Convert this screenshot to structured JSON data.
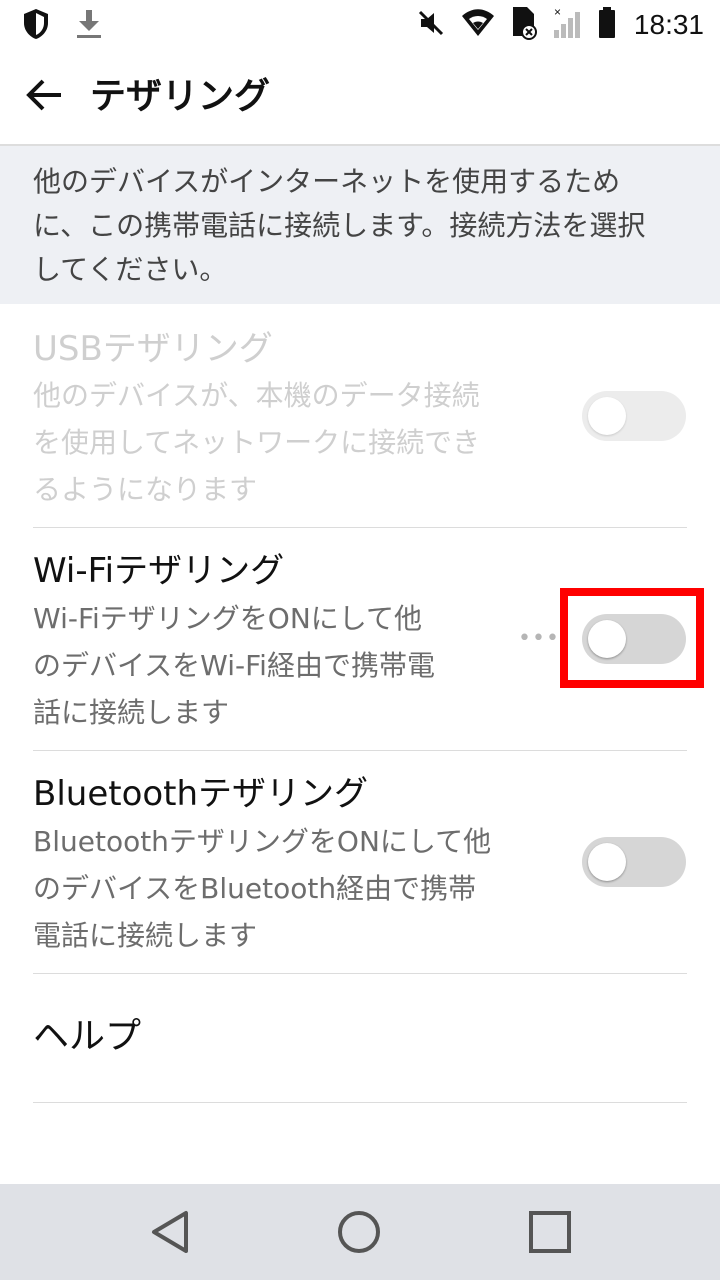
{
  "status_bar": {
    "time": "18:31",
    "icons_left": [
      "shield-icon",
      "download-icon"
    ],
    "icons_right": [
      "mute-icon",
      "wifi-icon",
      "sim-icon",
      "signal-icon",
      "battery-icon"
    ]
  },
  "app_bar": {
    "title": "テザリング",
    "back_icon": "arrow-back-icon"
  },
  "description": "他のデバイスがインターネットを使用するために、この携帯電話に接続します。接続方法を選択してください。",
  "settings": [
    {
      "title": "USBテザリング",
      "summary_lines": [
        "他のデバイスが、本機のデータ接続",
        "を使用してネットワークに接続でき",
        "るようになります"
      ],
      "enabled": false,
      "on": false
    },
    {
      "title": "Wi-Fiテザリング",
      "summary_lines": [
        "Wi-FiテザリングをONにして他",
        "のデバイスをWi-Fi経由で携帯電",
        "話に接続します"
      ],
      "enabled": true,
      "on": false
    },
    {
      "title": "Bluetoothテザリング",
      "summary_lines": [
        "BluetoothテザリングをONにして他",
        "のデバイスをBluetooth経由で携帯",
        "電話に接続します"
      ],
      "enabled": true,
      "on": false
    }
  ],
  "help": {
    "label": "ヘルプ"
  },
  "nav_bar": {
    "icons": [
      "back-triangle-icon",
      "home-circle-icon",
      "recents-square-icon"
    ]
  },
  "colors": {
    "highlight": "#ff0000",
    "switch_off": "#d6d6d6",
    "description_bg": "#eef0f4",
    "nav_bg": "#dfe1e6"
  }
}
